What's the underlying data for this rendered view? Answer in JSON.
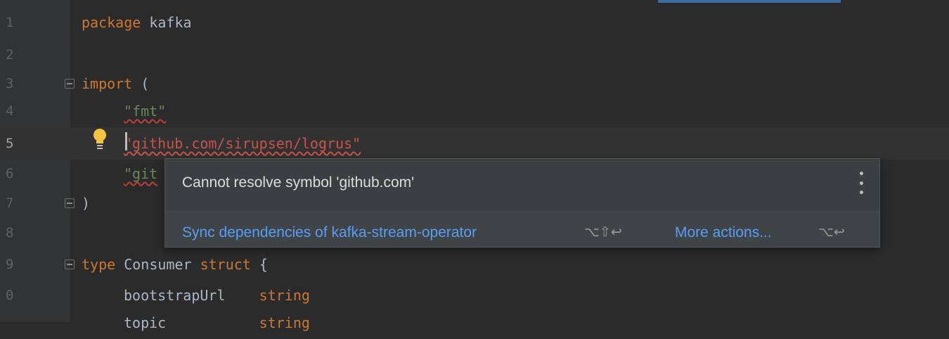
{
  "editor": {
    "lines": [
      {
        "num": "1"
      },
      {
        "num": "2"
      },
      {
        "num": "3"
      },
      {
        "num": "4"
      },
      {
        "num": "5"
      },
      {
        "num": "6"
      },
      {
        "num": "7"
      },
      {
        "num": "8"
      },
      {
        "num": "9"
      },
      {
        "num": "0"
      },
      {
        "num": ""
      }
    ],
    "code": {
      "package_kw": "package",
      "package_name": "kafka",
      "import_kw": "import",
      "import_paren": "(",
      "import_fmt": "\"fmt\"",
      "import_logrus": "\"github.com/sirupsen/logrus\"",
      "import_partial": "\"git",
      "close_paren": ")",
      "type_kw": "type",
      "type_name": "Consumer",
      "struct_kw": "struct",
      "open_brace": "{",
      "field1_name": "bootstrapUrl",
      "field1_type": "string",
      "field2_name": "topic",
      "field2_type": "string"
    }
  },
  "popup": {
    "message": "Cannot resolve symbol 'github.com'",
    "action_sync": "Sync dependencies of kafka-stream-operator",
    "shortcut_sync": "⌥⇧↩",
    "action_more": "More actions...",
    "shortcut_more": "⌥↩"
  },
  "colors": {
    "background": "#2b2b2b",
    "keyword": "#cc7832",
    "string": "#6a8759",
    "error_string": "#c7544b",
    "link": "#589df6"
  },
  "icons": {
    "bulb": "lightbulb-icon",
    "more": "more-vertical-icon",
    "fold": "fold-icon"
  }
}
